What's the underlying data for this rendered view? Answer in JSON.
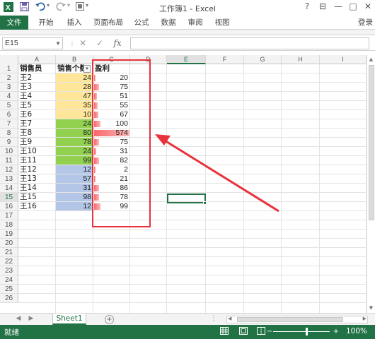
{
  "window": {
    "title": "工作簿1 - Excel",
    "help_icon": "?",
    "restore_icon": "⊟",
    "minimize_icon": "—",
    "maximize_icon": "□",
    "close_icon": "✕"
  },
  "quick_access": {
    "save_icon": "save-icon",
    "undo_icon": "undo-icon",
    "redo_icon": "redo-icon"
  },
  "ribbon": {
    "tabs": [
      "文件",
      "开始",
      "插入",
      "页面布局",
      "公式",
      "数据",
      "审阅",
      "视图"
    ],
    "login": "登录"
  },
  "formula_bar": {
    "name_box": "E15",
    "formula": ""
  },
  "columns": [
    "A",
    "B",
    "C",
    "D",
    "E",
    "F",
    "G",
    "H",
    "I"
  ],
  "active_column": "E",
  "active_row": 15,
  "rows": [
    1,
    2,
    3,
    4,
    5,
    6,
    7,
    8,
    9,
    10,
    11,
    12,
    13,
    14,
    15,
    16,
    17,
    18,
    19,
    20,
    21,
    22,
    23,
    24,
    25,
    26
  ],
  "table": {
    "headers": {
      "a": "销售员",
      "b": "销售个数",
      "c": "盈利"
    },
    "data": [
      {
        "name": "王2",
        "count": 24,
        "profit": 20,
        "fill": "#ffe699"
      },
      {
        "name": "王3",
        "count": 28,
        "profit": 75,
        "fill": "#ffe699"
      },
      {
        "name": "王4",
        "count": 47,
        "profit": 51,
        "fill": "#ffe699"
      },
      {
        "name": "王5",
        "count": 35,
        "profit": 55,
        "fill": "#ffe699"
      },
      {
        "name": "王6",
        "count": 10,
        "profit": 67,
        "fill": "#ffe699"
      },
      {
        "name": "王7",
        "count": 24,
        "profit": 100,
        "fill": "#92d050"
      },
      {
        "name": "王8",
        "count": 80,
        "profit": 574,
        "fill": "#92d050"
      },
      {
        "name": "王9",
        "count": 78,
        "profit": 75,
        "fill": "#92d050"
      },
      {
        "name": "王10",
        "count": 24,
        "profit": 31,
        "fill": "#92d050"
      },
      {
        "name": "王11",
        "count": 99,
        "profit": 82,
        "fill": "#92d050"
      },
      {
        "name": "王12",
        "count": 12,
        "profit": 2,
        "fill": "#b4c6e7"
      },
      {
        "name": "王13",
        "count": 57,
        "profit": 21,
        "fill": "#b4c6e7"
      },
      {
        "name": "王14",
        "count": 31,
        "profit": 86,
        "fill": "#b4c6e7"
      },
      {
        "name": "王15",
        "count": 98,
        "profit": 78,
        "fill": "#b4c6e7"
      },
      {
        "name": "王16",
        "count": 12,
        "profit": 99,
        "fill": "#b4c6e7"
      }
    ]
  },
  "colors": {
    "accent": "#217346",
    "databar": "#f8696b",
    "highlight": "#e8323c"
  },
  "sheets": [
    "Sheet1"
  ],
  "status": {
    "mode": "就绪",
    "zoom": "100%",
    "zoom_minus": "−",
    "zoom_plus": "+"
  }
}
